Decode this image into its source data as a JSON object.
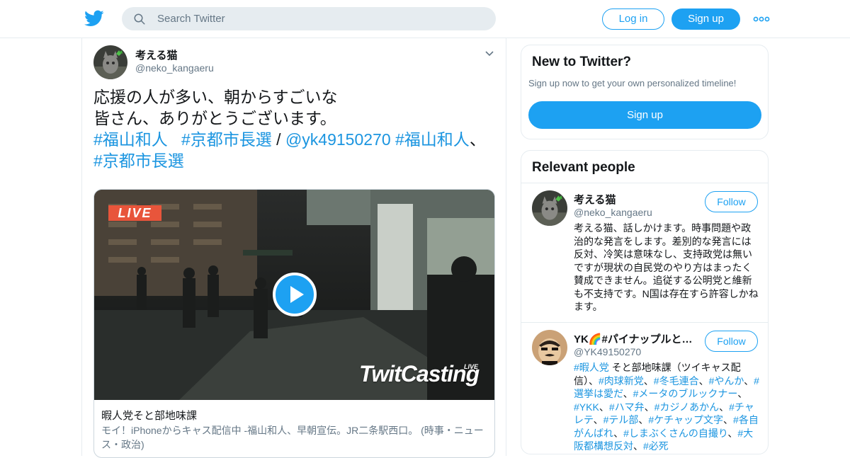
{
  "header": {
    "search_placeholder": "Search Twitter",
    "login_label": "Log in",
    "signup_label": "Sign up",
    "brand_color": "#1da1f2",
    "logo_icon": "twitter-bird-icon",
    "more_icon": "more-dots-icon"
  },
  "tweet": {
    "author_name": "考える猫",
    "author_handle": "@neko_kangaeru",
    "text_line1": "応援の人が多い、朝からすごいな",
    "text_line2": "皆さん、ありがとうございます。",
    "tag1": "#福山和人",
    "tag2": "#京都市長選",
    "separator": " / ",
    "mention": "@yk49150270",
    "tag3": "#福山和人",
    "comma": "、",
    "tag4": "#京都市長選",
    "media": {
      "live_badge": "LIVE",
      "watermark": "TwitCasting",
      "watermark_live": "LIVE",
      "card_title": "暇人党そと部地味課",
      "card_description": "モイ！iPhoneからキャス配信中 -福山和人、早朝宣伝。JR二条駅西口。 (時事・ニュース・政治)"
    }
  },
  "sidebar": {
    "new_to_twitter": {
      "title": "New to Twitter?",
      "subtitle": "Sign up now to get your own personalized timeline!",
      "signup_label": "Sign up"
    },
    "relevant_people": {
      "title": "Relevant people",
      "people": [
        {
          "name": "考える猫",
          "handle": "@neko_kangaeru",
          "follow_label": "Follow",
          "bio": "考える猫、話しかけます。時事問題や政治的な発言をします。差別的な発言には反対、冷笑は意味なし、支持政党は無いですが現状の自民党のやり方はまったく賛成できません。追従する公明党と維新も不支持です。N国は存在すら許容しかねます。"
        },
        {
          "name": "YK🌈#パイナップルと…",
          "handle": "@YK49150270",
          "follow_label": "Follow",
          "bio_parts": [
            {
              "text": "#暇人党",
              "link": true
            },
            {
              "text": " そと部地味課（ツイキャス配信）、",
              "link": false
            },
            {
              "text": "#肉球新党",
              "link": true
            },
            {
              "text": "、",
              "link": false
            },
            {
              "text": "#冬毛連合",
              "link": true
            },
            {
              "text": "、",
              "link": false
            },
            {
              "text": "#やんか",
              "link": true
            },
            {
              "text": "、",
              "link": false
            },
            {
              "text": "#選挙は愛だ",
              "link": true
            },
            {
              "text": "、",
              "link": false
            },
            {
              "text": "#メータのブルックナー",
              "link": true
            },
            {
              "text": "、",
              "link": false
            },
            {
              "text": "#YKK",
              "link": true
            },
            {
              "text": "、",
              "link": false
            },
            {
              "text": "#ハマ弁",
              "link": true
            },
            {
              "text": "、",
              "link": false
            },
            {
              "text": "#カジノあかん",
              "link": true
            },
            {
              "text": "、",
              "link": false
            },
            {
              "text": "#チャレテ",
              "link": true
            },
            {
              "text": "、",
              "link": false
            },
            {
              "text": "#テル部",
              "link": true
            },
            {
              "text": "、",
              "link": false
            },
            {
              "text": "#ケチャップ文字",
              "link": true
            },
            {
              "text": "、",
              "link": false
            },
            {
              "text": "#各自がんばれ",
              "link": true
            },
            {
              "text": "、",
              "link": false
            },
            {
              "text": "#しまぶくさんの自撮り",
              "link": true
            },
            {
              "text": "、",
              "link": false
            },
            {
              "text": "#大阪都構想反対",
              "link": true
            },
            {
              "text": "、",
              "link": false
            },
            {
              "text": "#必死",
              "link": true
            }
          ]
        }
      ]
    }
  }
}
